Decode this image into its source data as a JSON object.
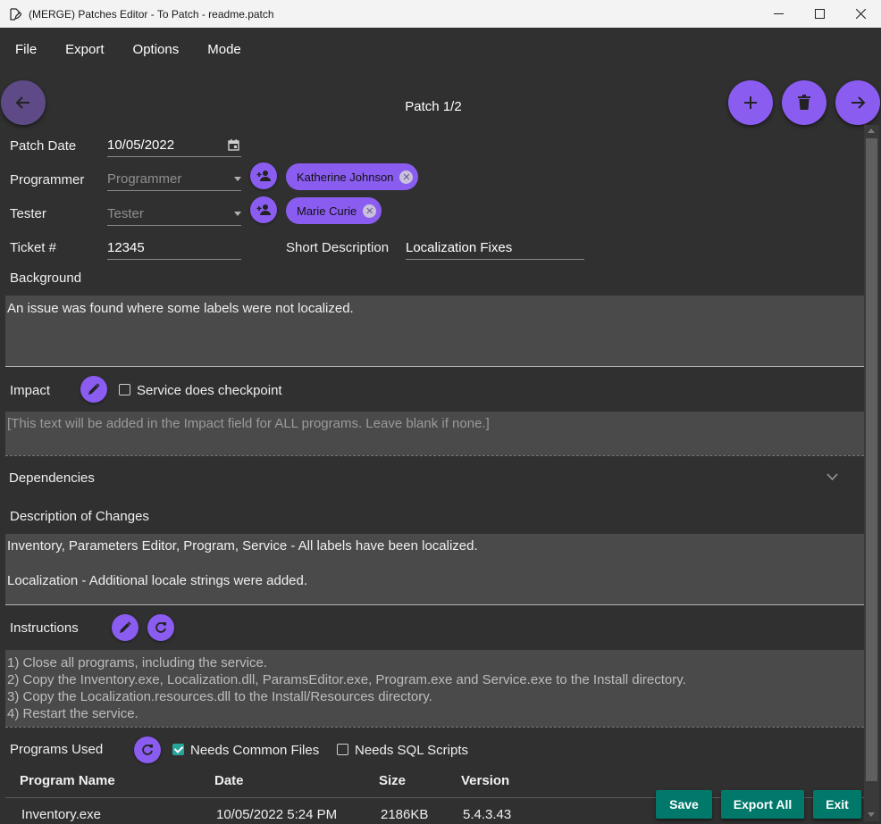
{
  "window": {
    "title": "(MERGE) Patches Editor - To Patch - readme.patch"
  },
  "menu": [
    "File",
    "Export",
    "Options",
    "Mode"
  ],
  "patch_nav": {
    "label": "Patch 1/2"
  },
  "form": {
    "patch_date_label": "Patch Date",
    "patch_date_value": "10/05/2022",
    "programmer_label": "Programmer",
    "programmer_placeholder": "Programmer",
    "programmer_chip": "Katherine Johnson",
    "tester_label": "Tester",
    "tester_placeholder": "Tester",
    "tester_chip": "Marie Curie",
    "ticket_label": "Ticket #",
    "ticket_value": "12345",
    "short_desc_label": "Short Description",
    "short_desc_value": "Localization Fixes",
    "background_label": "Background",
    "background_text": "An issue was found where some labels were not localized.",
    "impact_label": "Impact",
    "service_checkpoint_label": "Service does checkpoint",
    "impact_placeholder": "[This text will be added in the Impact field for ALL programs. Leave blank if none.]",
    "dependencies_label": "Dependencies",
    "changes_label": "Description of Changes",
    "changes_lines": [
      "Inventory, Parameters Editor, Program, Service - All labels have been localized.",
      "Localization - Additional locale strings were added."
    ],
    "instructions_label": "Instructions",
    "instructions_lines": [
      "1) Close all programs, including the service.",
      "2) Copy the Inventory.exe, Localization.dll, ParamsEditor.exe, Program.exe and Service.exe to the Install directory.",
      "3) Copy the Localization.resources.dll to the Install/Resources directory.",
      "4) Restart the service."
    ],
    "programs_used_label": "Programs Used",
    "needs_common_label": "Needs Common Files",
    "needs_common_checked": true,
    "needs_sql_label": "Needs SQL Scripts",
    "needs_sql_checked": false
  },
  "programs_table": {
    "headers": [
      "Program Name",
      "Date",
      "Size",
      "Version"
    ],
    "rows": [
      [
        "Inventory.exe",
        "10/05/2022 5:24 PM",
        "2186KB",
        "5.4.3.43"
      ]
    ]
  },
  "actions": {
    "save": "Save",
    "export_all": "Export All",
    "exit": "Exit"
  },
  "colors": {
    "accent": "#8a5cf0",
    "action": "#00796b",
    "background": "#303030",
    "text_area": "#4a4a4a"
  }
}
